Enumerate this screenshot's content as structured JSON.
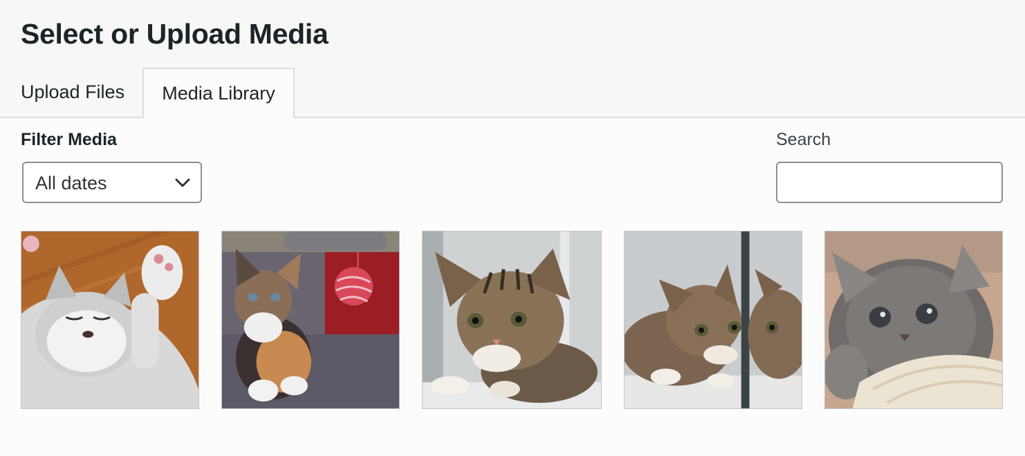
{
  "header": {
    "title": "Select or Upload Media"
  },
  "tabs": [
    {
      "label": "Upload Files",
      "active": false
    },
    {
      "label": "Media Library",
      "active": true
    }
  ],
  "filter": {
    "label": "Filter Media",
    "selected": "All dates",
    "icon": "chevron-down-icon"
  },
  "search": {
    "label": "Search",
    "value": "",
    "placeholder": ""
  },
  "attachments": [
    {
      "subject": "sleeping gray and white kitten on wooden floor"
    },
    {
      "subject": "calico kitten with red yarn ball toy"
    },
    {
      "subject": "tabby kitten lying by window"
    },
    {
      "subject": "tabby kitten next to glass reflection"
    },
    {
      "subject": "gray fluffy kitten on beige blanket"
    }
  ]
}
